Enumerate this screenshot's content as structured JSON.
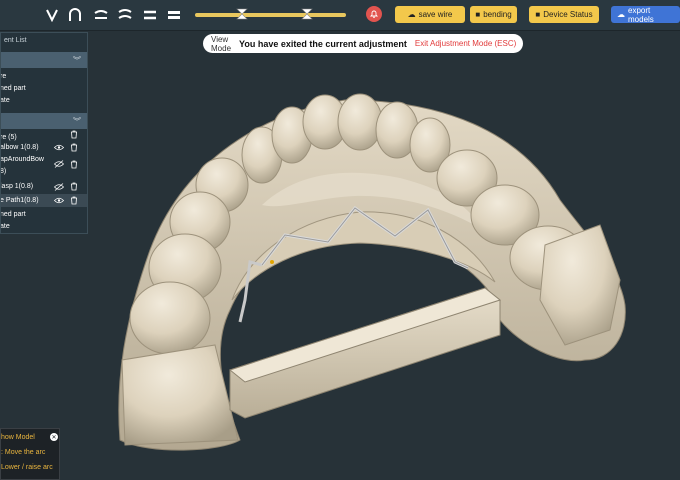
{
  "toolbar": {
    "tools": [
      {
        "name": "wire-shape-v-icon"
      },
      {
        "name": "wire-shape-u-icon"
      },
      {
        "name": "wire-shape-wave-icon"
      },
      {
        "name": "wire-shape-double-wave-icon"
      },
      {
        "name": "wire-shape-double-line-icon"
      },
      {
        "name": "wire-shape-bar-icon"
      }
    ],
    "sliders": [
      {
        "name": "slider-1",
        "value": 0.53
      },
      {
        "name": "slider-2",
        "value": 0.55
      }
    ],
    "save_label": "save wire",
    "bending_label": "bending",
    "device_status_label": "Device Status",
    "export_label": "export models",
    "colors": {
      "accent": "#f3c84b",
      "export": "#3f74d6",
      "bell": "#e2544f"
    }
  },
  "mode_bar": {
    "label": "View Mode",
    "message": "You have exited the current adjustment",
    "exit_label": "Exit Adjustment Mode (ESC)"
  },
  "panel": {
    "title": "ent List",
    "group1": {
      "items": [
        "re",
        "ned part",
        "ate"
      ]
    },
    "group2": {
      "items": [
        "re (5)",
        "albow 1(0.8)",
        "apAroundBow",
        "8)",
        "lasp 1(0.8)",
        "e Path1(0.8)",
        "ned part",
        "ate"
      ]
    }
  },
  "tips": {
    "line1": "how Model",
    "line2": ": Move the arc",
    "line3": "Lower / raise arc"
  }
}
